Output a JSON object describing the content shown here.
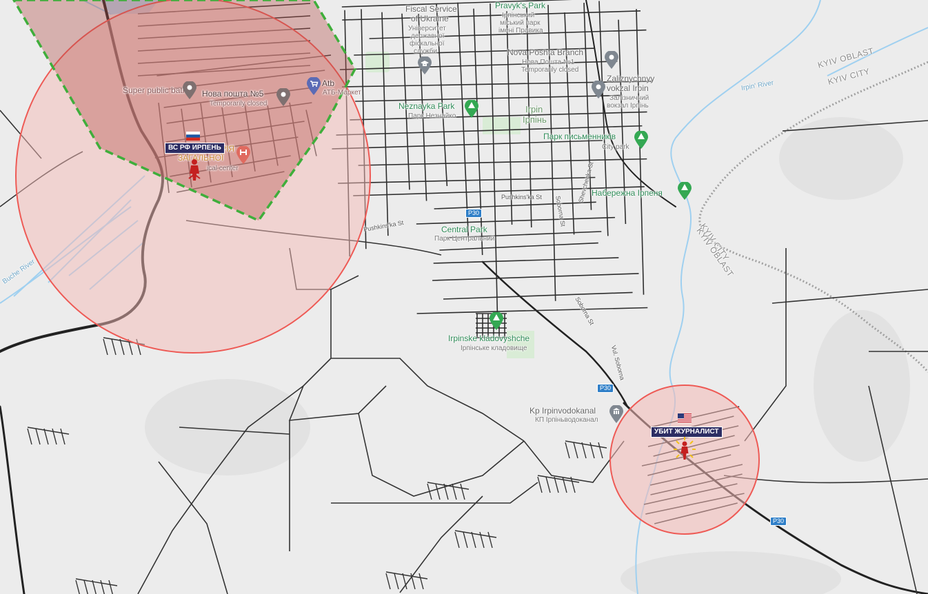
{
  "places": {
    "fiscal_service": "Fiscal Service",
    "fiscal_sub": "of Ukraine",
    "fiscal_ua1": "Університет",
    "fiscal_ua2": "державної",
    "fiscal_ua3": "фіскальної",
    "fiscal_ua4": "служби",
    "pravyk_park": "Pravyk's Park",
    "pravyk_ua1": "Ірпінський",
    "pravyk_ua2": "міський парк",
    "pravyk_ua3": "імені Правика",
    "nova_poshta": "Nova Poshta Branch",
    "nova_poshta_ua": "Нова Пошта №1",
    "nova_poshta_status": "Temporarily closed",
    "zaliz_station": "Zaliznychnyy",
    "zaliz_station2": "vokzal Irpin",
    "zaliz_ua1": "Залізничний",
    "zaliz_ua2": "вокзал Ірпінь",
    "neznayka_park": "Neznayka Park",
    "neznayka_ua": "Парк Незнайко",
    "irpin": "Irpin",
    "irpin_ua": "Ірпінь",
    "park_pysmennykiv": "Парк письменників",
    "city_park": "City park",
    "naberezhna": "Набережна Ірпеня",
    "central_park": "Central Park",
    "central_park_ua": "Парк Центральний",
    "cemetery": "Irpinske kladovyshche",
    "cemetery_ua": "Ірпінське кладовище",
    "vodokanal": "Kp Irpinvodokanal",
    "vodokanal_ua": "КП Ірпіньводоканал",
    "super_bath": "Super public bath",
    "nova_poshta5": "Нова пошта №5",
    "nova_poshta5_status": "Temporarily closed",
    "atb": "Atb",
    "atb_ua": "АТБ-Маркет",
    "hospital1": "РІЯ",
    "hospital2": "ЗАГАЛЬНОЇ",
    "hospital3": "ical center"
  },
  "roads": {
    "pushkins": "Pushkins'ka St",
    "pushkins2": "Pushkins'ka St",
    "soborna": "Soborna St",
    "soborna2": "Vul. Soborna",
    "soborna3": "Soborna St",
    "shevchenka": "Shevchenka St",
    "buche_river": "Buche River",
    "irpin_river": "Irpin' River",
    "r30a": "P30",
    "r30b": "P30",
    "r30c": "P30"
  },
  "regions": {
    "kyiv_oblast_1": "KYIV OBLAST",
    "kyiv_city_1": "KYIV CITY",
    "kyiv_city_2": "KYIV CITY",
    "kyiv_oblast_2": "KYIV OBLAST"
  },
  "markers": {
    "russian_forces": "ВС РФ ИРПЕНЬ",
    "journalist": "УБИТ ЖУРНАЛИСТ"
  },
  "colors": {
    "danger_fill": "#f4b9b6",
    "danger_stroke": "#ee5a55",
    "control_fill": "#b4504a",
    "control_border": "#3fae3b",
    "road": "#2a2a2a",
    "water": "#9fd0f0",
    "park_icon": "#34a853",
    "pin_grey": "#7f8790"
  },
  "icons": [
    "park-icon",
    "university-icon",
    "place-pin-icon",
    "shopping-cart-icon",
    "hospital-icon",
    "museum-icon",
    "soldier-marker-icon",
    "russia-flag-icon",
    "usa-flag-icon"
  ]
}
